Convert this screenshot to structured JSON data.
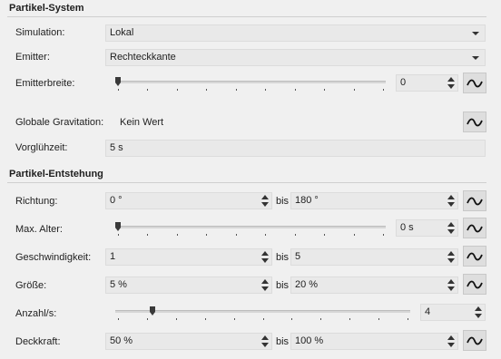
{
  "sections": {
    "particle_system": "Partikel-System",
    "particle_emission": "Partikel-Entstehung"
  },
  "rows": {
    "simulation": {
      "label": "Simulation:",
      "value": "Lokal"
    },
    "emitter": {
      "label": "Emitter:",
      "value": "Rechteckkante"
    },
    "emitter_width": {
      "label": "Emitterbreite:",
      "value": "0",
      "slider_fraction": 0.0
    },
    "global_gravity": {
      "label": "Globale Gravitation:",
      "value": "Kein Wert"
    },
    "preglow_time": {
      "label": "Vorglühzeit:",
      "value": "5 s"
    },
    "direction": {
      "label": "Richtung:",
      "from": "0 °",
      "bis": "bis",
      "to": "180 °"
    },
    "max_age": {
      "label": "Max. Alter:",
      "value": "0 s",
      "slider_fraction": 0.0
    },
    "speed": {
      "label": "Geschwindigkeit:",
      "from": "1",
      "bis": "bis",
      "to": "5"
    },
    "size": {
      "label": "Größe:",
      "from": "5 %",
      "bis": "bis",
      "to": "20 %"
    },
    "count_per_s": {
      "label": "Anzahl/s:",
      "value": "4",
      "slider_fraction": 0.12
    },
    "opacity": {
      "label": "Deckkraft:",
      "from": "50 %",
      "bis": "bis",
      "to": "100 %"
    }
  },
  "icons": {
    "curve": "curve-editor-icon",
    "dropdown": "chevron-down-icon",
    "spin": "spin-arrows-icon"
  },
  "colors": {
    "background": "#f0f0f0",
    "field": "#e9e9e9",
    "button": "#dedede"
  }
}
